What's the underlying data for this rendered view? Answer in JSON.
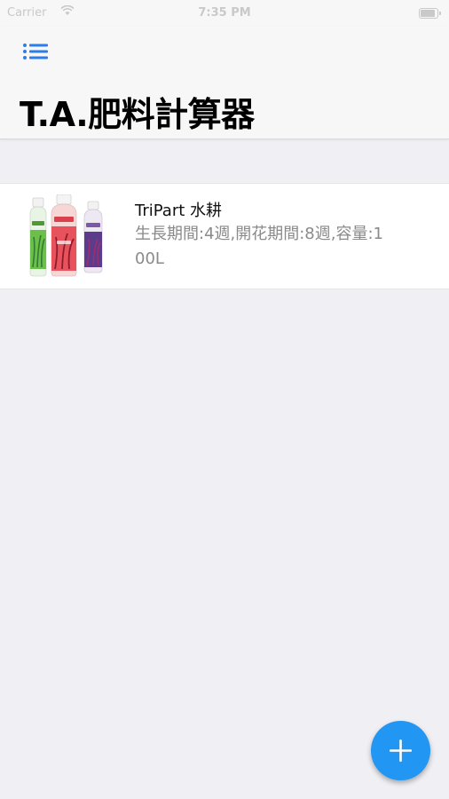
{
  "status_bar": {
    "carrier": "Carrier",
    "time": "7:35 PM"
  },
  "header": {
    "title": "T.A.肥料計算器",
    "menu_icon": "list-icon",
    "accent_color": "#2b7de9"
  },
  "list": {
    "items": [
      {
        "title": "TriPart 水耕",
        "detail": "生長期間:4週,開花期間:8週,容量:100L",
        "image": "tripart-bottles-image"
      }
    ]
  },
  "fab": {
    "icon": "plus-icon",
    "color": "#2196f3"
  }
}
